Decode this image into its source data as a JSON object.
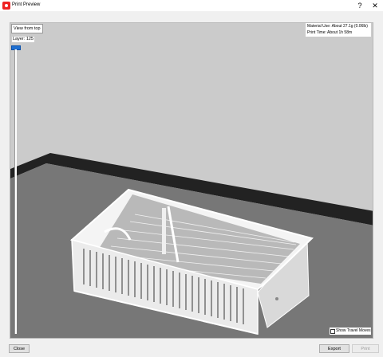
{
  "window": {
    "title": "Print Preview",
    "help_glyph": "?",
    "close_glyph": "✕"
  },
  "viewport": {
    "view_button": "View from top",
    "layer_label": "Layer: 125",
    "layer_slider_level": 1.0,
    "material_use": "Material Use: About 27.1g (0.06lb)",
    "print_time": "Print Time: About 1h 58m",
    "show_travel_moves_label": "Show Travel Moves",
    "show_travel_moves_checked": false
  },
  "buttons": {
    "close": "Close",
    "export": "Export",
    "print": "Print"
  },
  "colors": {
    "background": "#cbcbcb",
    "bed": "#777777",
    "bed_edge": "#222222",
    "model": "#ffffff",
    "accent": "#1f6fd0"
  }
}
